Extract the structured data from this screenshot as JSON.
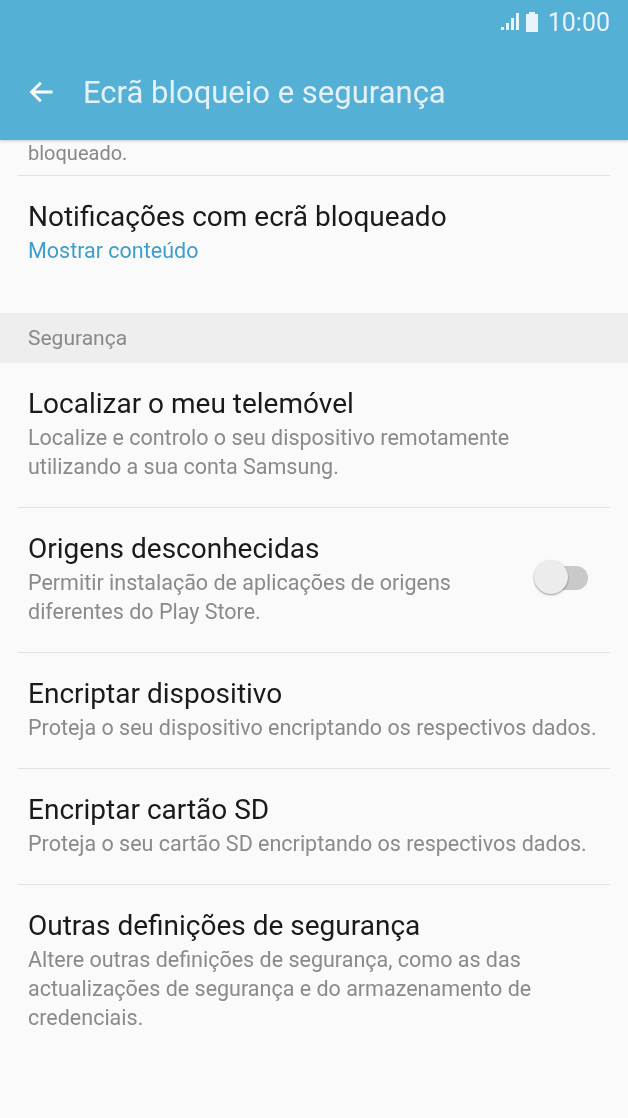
{
  "status_bar": {
    "time": "10:00"
  },
  "toolbar": {
    "title": "Ecrã bloqueio e segurança"
  },
  "partial_text": "bloqueado.",
  "sections": [
    {
      "items": [
        {
          "kind": "value",
          "title": "Notificações com ecrã bloqueado",
          "subtitle": "Mostrar conteúdo"
        }
      ]
    },
    {
      "header": "Segurança",
      "items": [
        {
          "kind": "plain",
          "title": "Localizar o meu telemóvel",
          "subtitle": "Localize e controlo o seu dispositivo remotamente utilizando a sua conta Samsung."
        },
        {
          "kind": "switch",
          "title": "Origens desconhecidas",
          "subtitle": "Permitir instalação de aplicações de origens diferentes do Play Store.",
          "on": false
        },
        {
          "kind": "plain",
          "title": "Encriptar dispositivo",
          "subtitle": "Proteja o seu dispositivo encriptando os respectivos dados."
        },
        {
          "kind": "plain",
          "title": "Encriptar cartão SD",
          "subtitle": "Proteja o seu cartão SD encriptando os respectivos dados."
        },
        {
          "kind": "plain",
          "title": "Outras definições de segurança",
          "subtitle": "Altere outras definições de segurança, como as das actualizações de segurança e do armazenamento de credenciais."
        }
      ]
    }
  ]
}
